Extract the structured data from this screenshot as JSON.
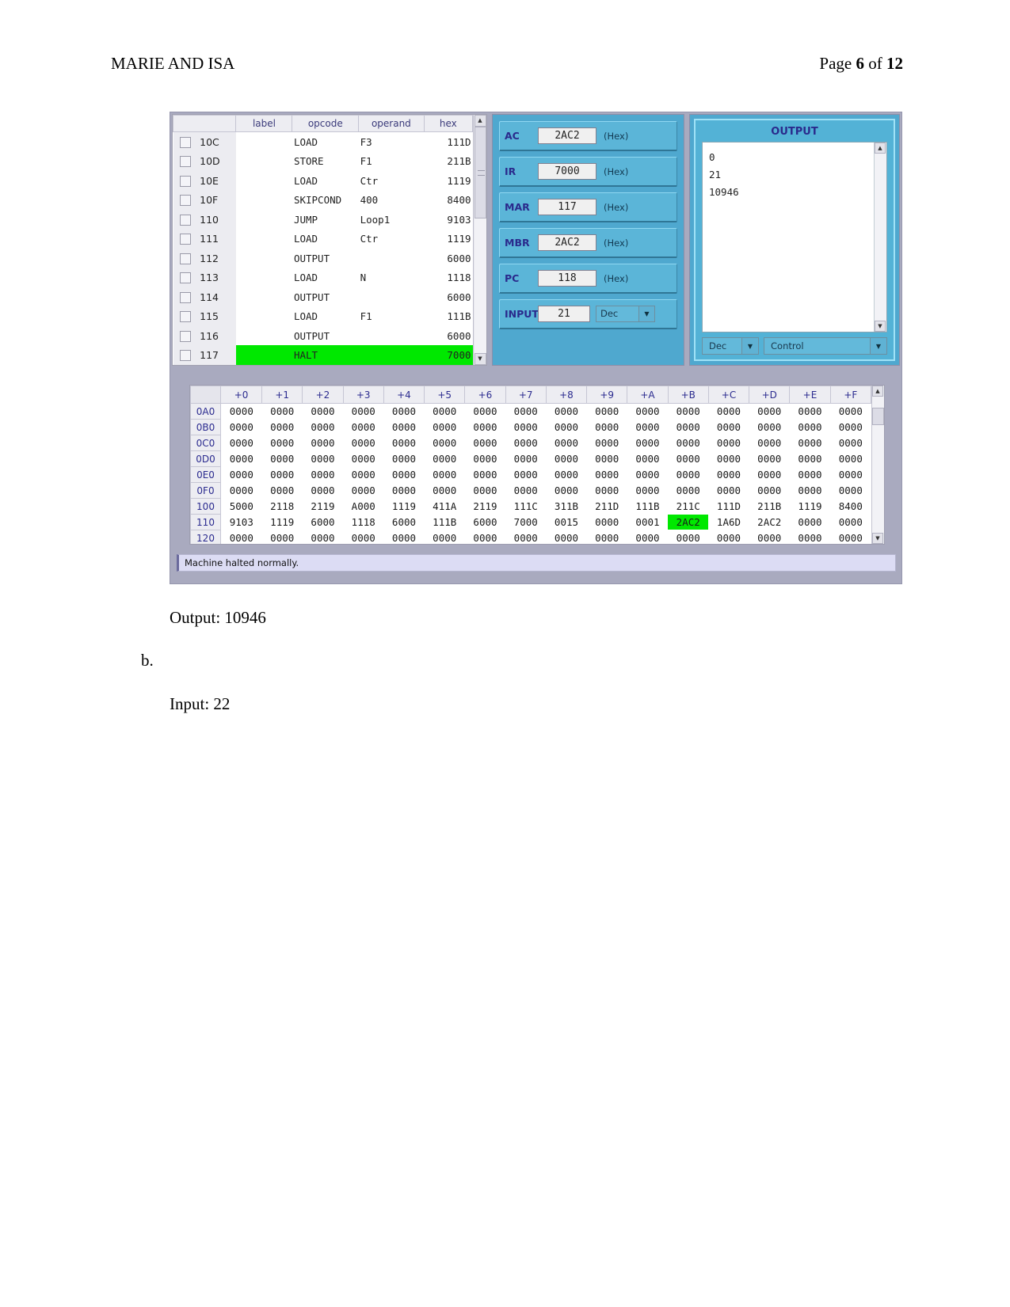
{
  "document": {
    "header_title": "MARIE AND ISA",
    "page_label_prefix": "Page ",
    "page_current": "6",
    "page_label_middle": " of ",
    "page_total": "12",
    "output_line": "Output: 10946",
    "item_b_label": "b.",
    "input_line": "Input: 22"
  },
  "simulator": {
    "listing": {
      "columns": [
        "label",
        "opcode",
        "operand",
        "hex"
      ],
      "rows": [
        {
          "addr": "10C",
          "label": "",
          "opcode": "LOAD",
          "operand": "F3",
          "hex": "111D",
          "highlight": false
        },
        {
          "addr": "10D",
          "label": "",
          "opcode": "STORE",
          "operand": "F1",
          "hex": "211B",
          "highlight": false
        },
        {
          "addr": "10E",
          "label": "",
          "opcode": "LOAD",
          "operand": "Ctr",
          "hex": "1119",
          "highlight": false
        },
        {
          "addr": "10F",
          "label": "",
          "opcode": "SKIPCOND",
          "operand": "400",
          "hex": "8400",
          "highlight": false
        },
        {
          "addr": "110",
          "label": "",
          "opcode": "JUMP",
          "operand": "Loop1",
          "hex": "9103",
          "highlight": false
        },
        {
          "addr": "111",
          "label": "",
          "opcode": "LOAD",
          "operand": "Ctr",
          "hex": "1119",
          "highlight": false
        },
        {
          "addr": "112",
          "label": "",
          "opcode": "OUTPUT",
          "operand": "",
          "hex": "6000",
          "highlight": false
        },
        {
          "addr": "113",
          "label": "",
          "opcode": "LOAD",
          "operand": "N",
          "hex": "1118",
          "highlight": false
        },
        {
          "addr": "114",
          "label": "",
          "opcode": "OUTPUT",
          "operand": "",
          "hex": "6000",
          "highlight": false
        },
        {
          "addr": "115",
          "label": "",
          "opcode": "LOAD",
          "operand": "F1",
          "hex": "111B",
          "highlight": false
        },
        {
          "addr": "116",
          "label": "",
          "opcode": "OUTPUT",
          "operand": "",
          "hex": "6000",
          "highlight": false
        },
        {
          "addr": "117",
          "label": "",
          "opcode": "HALT",
          "operand": "",
          "hex": "7000",
          "highlight": true
        }
      ]
    },
    "registers": [
      {
        "name": "AC",
        "value": "2AC2",
        "unit": "(Hex)",
        "has_select": false
      },
      {
        "name": "IR",
        "value": "7000",
        "unit": "(Hex)",
        "has_select": false
      },
      {
        "name": "MAR",
        "value": "117",
        "unit": "(Hex)",
        "has_select": false
      },
      {
        "name": "MBR",
        "value": "2AC2",
        "unit": "(Hex)",
        "has_select": false
      },
      {
        "name": "PC",
        "value": "118",
        "unit": "(Hex)",
        "has_select": false
      },
      {
        "name": "INPUT",
        "value": "21",
        "unit": "",
        "has_select": true,
        "select_value": "Dec"
      }
    ],
    "output_panel": {
      "title": "OUTPUT",
      "lines": "0\n21\n10946",
      "base_select": "Dec",
      "control_select": "Control"
    },
    "memory": {
      "column_headers": [
        "+0",
        "+1",
        "+2",
        "+3",
        "+4",
        "+5",
        "+6",
        "+7",
        "+8",
        "+9",
        "+A",
        "+B",
        "+C",
        "+D",
        "+E",
        "+F"
      ],
      "rows": [
        {
          "addr": "0A0",
          "cells": [
            "0000",
            "0000",
            "0000",
            "0000",
            "0000",
            "0000",
            "0000",
            "0000",
            "0000",
            "0000",
            "0000",
            "0000",
            "0000",
            "0000",
            "0000",
            "0000"
          ],
          "highlight_index": -1
        },
        {
          "addr": "0B0",
          "cells": [
            "0000",
            "0000",
            "0000",
            "0000",
            "0000",
            "0000",
            "0000",
            "0000",
            "0000",
            "0000",
            "0000",
            "0000",
            "0000",
            "0000",
            "0000",
            "0000"
          ],
          "highlight_index": -1
        },
        {
          "addr": "0C0",
          "cells": [
            "0000",
            "0000",
            "0000",
            "0000",
            "0000",
            "0000",
            "0000",
            "0000",
            "0000",
            "0000",
            "0000",
            "0000",
            "0000",
            "0000",
            "0000",
            "0000"
          ],
          "highlight_index": -1
        },
        {
          "addr": "0D0",
          "cells": [
            "0000",
            "0000",
            "0000",
            "0000",
            "0000",
            "0000",
            "0000",
            "0000",
            "0000",
            "0000",
            "0000",
            "0000",
            "0000",
            "0000",
            "0000",
            "0000"
          ],
          "highlight_index": -1
        },
        {
          "addr": "0E0",
          "cells": [
            "0000",
            "0000",
            "0000",
            "0000",
            "0000",
            "0000",
            "0000",
            "0000",
            "0000",
            "0000",
            "0000",
            "0000",
            "0000",
            "0000",
            "0000",
            "0000"
          ],
          "highlight_index": -1
        },
        {
          "addr": "0F0",
          "cells": [
            "0000",
            "0000",
            "0000",
            "0000",
            "0000",
            "0000",
            "0000",
            "0000",
            "0000",
            "0000",
            "0000",
            "0000",
            "0000",
            "0000",
            "0000",
            "0000"
          ],
          "highlight_index": -1
        },
        {
          "addr": "100",
          "cells": [
            "5000",
            "2118",
            "2119",
            "A000",
            "1119",
            "411A",
            "2119",
            "111C",
            "311B",
            "211D",
            "111B",
            "211C",
            "111D",
            "211B",
            "1119",
            "8400"
          ],
          "highlight_index": -1
        },
        {
          "addr": "110",
          "cells": [
            "9103",
            "1119",
            "6000",
            "1118",
            "6000",
            "111B",
            "6000",
            "7000",
            "0015",
            "0000",
            "0001",
            "2AC2",
            "1A6D",
            "2AC2",
            "0000",
            "0000"
          ],
          "highlight_index": 11
        },
        {
          "addr": "120",
          "cells": [
            "0000",
            "0000",
            "0000",
            "0000",
            "0000",
            "0000",
            "0000",
            "0000",
            "0000",
            "0000",
            "0000",
            "0000",
            "0000",
            "0000",
            "0000",
            "0000"
          ],
          "highlight_index": -1
        }
      ]
    },
    "status_bar": "Machine halted normally.",
    "colors": {
      "highlight_green": "#00e800",
      "panel_blue": "#4fa8cf",
      "frame_gray": "#a9aabf",
      "register_label": "#2a2a8c"
    }
  }
}
